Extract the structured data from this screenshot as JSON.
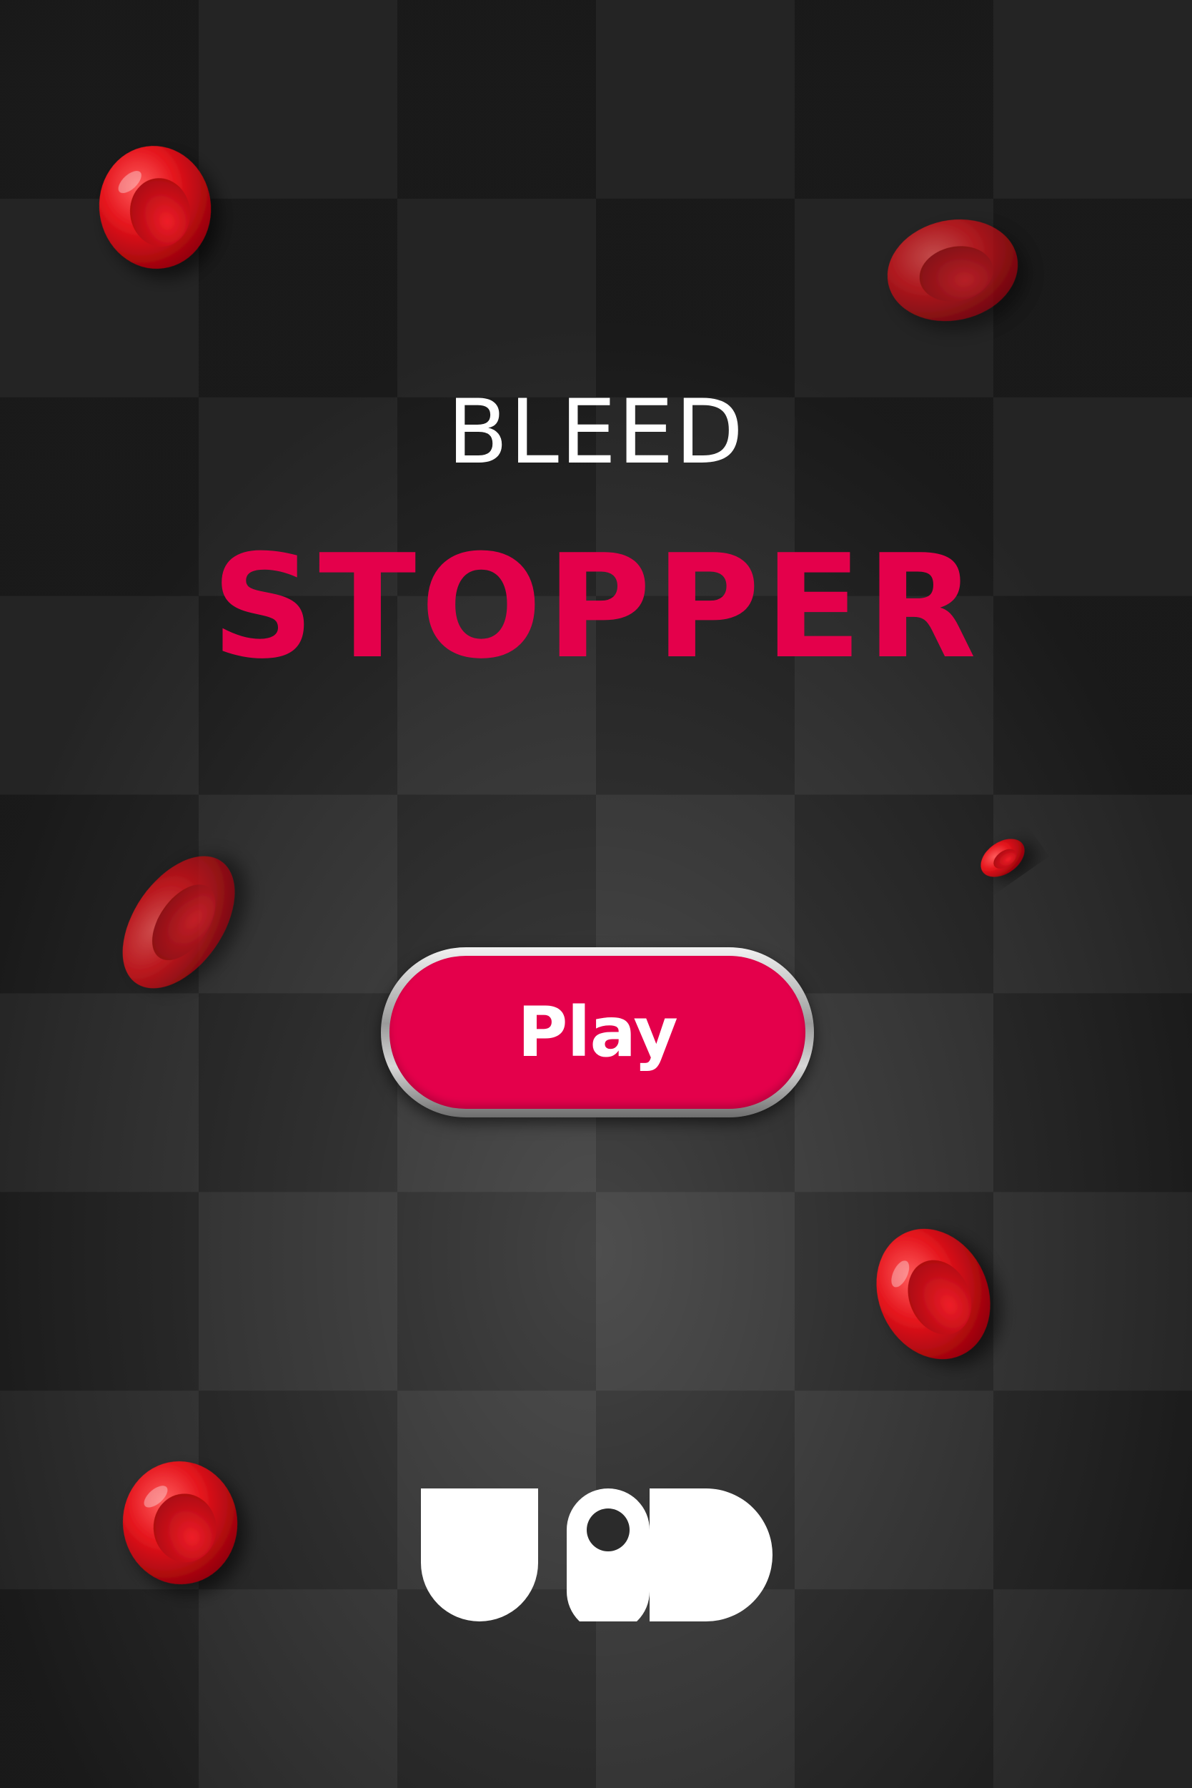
{
  "title": {
    "line1": "BLEED",
    "line2": "STOPPER"
  },
  "play_button": {
    "label": "Play"
  },
  "logo": {
    "text": "UiD"
  },
  "icons": {
    "blood_cell": "blood-cell-icon",
    "logo": "uid-logo-icon"
  },
  "colors": {
    "accent": "#e4004b",
    "background": "#2b2b2b",
    "title_text": "#ffffff",
    "blood_cell": "#e0141e"
  }
}
